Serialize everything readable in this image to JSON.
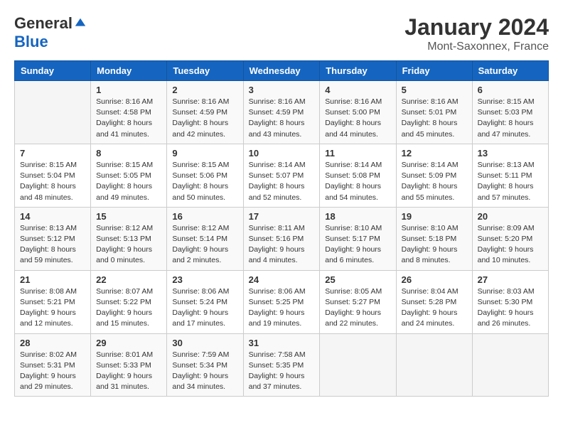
{
  "header": {
    "logo_general": "General",
    "logo_blue": "Blue",
    "month": "January 2024",
    "location": "Mont-Saxonnex, France"
  },
  "weekdays": [
    "Sunday",
    "Monday",
    "Tuesday",
    "Wednesday",
    "Thursday",
    "Friday",
    "Saturday"
  ],
  "weeks": [
    [
      {
        "day": "",
        "info": ""
      },
      {
        "day": "1",
        "info": "Sunrise: 8:16 AM\nSunset: 4:58 PM\nDaylight: 8 hours\nand 41 minutes."
      },
      {
        "day": "2",
        "info": "Sunrise: 8:16 AM\nSunset: 4:59 PM\nDaylight: 8 hours\nand 42 minutes."
      },
      {
        "day": "3",
        "info": "Sunrise: 8:16 AM\nSunset: 4:59 PM\nDaylight: 8 hours\nand 43 minutes."
      },
      {
        "day": "4",
        "info": "Sunrise: 8:16 AM\nSunset: 5:00 PM\nDaylight: 8 hours\nand 44 minutes."
      },
      {
        "day": "5",
        "info": "Sunrise: 8:16 AM\nSunset: 5:01 PM\nDaylight: 8 hours\nand 45 minutes."
      },
      {
        "day": "6",
        "info": "Sunrise: 8:15 AM\nSunset: 5:03 PM\nDaylight: 8 hours\nand 47 minutes."
      }
    ],
    [
      {
        "day": "7",
        "info": "Sunrise: 8:15 AM\nSunset: 5:04 PM\nDaylight: 8 hours\nand 48 minutes."
      },
      {
        "day": "8",
        "info": "Sunrise: 8:15 AM\nSunset: 5:05 PM\nDaylight: 8 hours\nand 49 minutes."
      },
      {
        "day": "9",
        "info": "Sunrise: 8:15 AM\nSunset: 5:06 PM\nDaylight: 8 hours\nand 50 minutes."
      },
      {
        "day": "10",
        "info": "Sunrise: 8:14 AM\nSunset: 5:07 PM\nDaylight: 8 hours\nand 52 minutes."
      },
      {
        "day": "11",
        "info": "Sunrise: 8:14 AM\nSunset: 5:08 PM\nDaylight: 8 hours\nand 54 minutes."
      },
      {
        "day": "12",
        "info": "Sunrise: 8:14 AM\nSunset: 5:09 PM\nDaylight: 8 hours\nand 55 minutes."
      },
      {
        "day": "13",
        "info": "Sunrise: 8:13 AM\nSunset: 5:11 PM\nDaylight: 8 hours\nand 57 minutes."
      }
    ],
    [
      {
        "day": "14",
        "info": "Sunrise: 8:13 AM\nSunset: 5:12 PM\nDaylight: 8 hours\nand 59 minutes."
      },
      {
        "day": "15",
        "info": "Sunrise: 8:12 AM\nSunset: 5:13 PM\nDaylight: 9 hours\nand 0 minutes."
      },
      {
        "day": "16",
        "info": "Sunrise: 8:12 AM\nSunset: 5:14 PM\nDaylight: 9 hours\nand 2 minutes."
      },
      {
        "day": "17",
        "info": "Sunrise: 8:11 AM\nSunset: 5:16 PM\nDaylight: 9 hours\nand 4 minutes."
      },
      {
        "day": "18",
        "info": "Sunrise: 8:10 AM\nSunset: 5:17 PM\nDaylight: 9 hours\nand 6 minutes."
      },
      {
        "day": "19",
        "info": "Sunrise: 8:10 AM\nSunset: 5:18 PM\nDaylight: 9 hours\nand 8 minutes."
      },
      {
        "day": "20",
        "info": "Sunrise: 8:09 AM\nSunset: 5:20 PM\nDaylight: 9 hours\nand 10 minutes."
      }
    ],
    [
      {
        "day": "21",
        "info": "Sunrise: 8:08 AM\nSunset: 5:21 PM\nDaylight: 9 hours\nand 12 minutes."
      },
      {
        "day": "22",
        "info": "Sunrise: 8:07 AM\nSunset: 5:22 PM\nDaylight: 9 hours\nand 15 minutes."
      },
      {
        "day": "23",
        "info": "Sunrise: 8:06 AM\nSunset: 5:24 PM\nDaylight: 9 hours\nand 17 minutes."
      },
      {
        "day": "24",
        "info": "Sunrise: 8:06 AM\nSunset: 5:25 PM\nDaylight: 9 hours\nand 19 minutes."
      },
      {
        "day": "25",
        "info": "Sunrise: 8:05 AM\nSunset: 5:27 PM\nDaylight: 9 hours\nand 22 minutes."
      },
      {
        "day": "26",
        "info": "Sunrise: 8:04 AM\nSunset: 5:28 PM\nDaylight: 9 hours\nand 24 minutes."
      },
      {
        "day": "27",
        "info": "Sunrise: 8:03 AM\nSunset: 5:30 PM\nDaylight: 9 hours\nand 26 minutes."
      }
    ],
    [
      {
        "day": "28",
        "info": "Sunrise: 8:02 AM\nSunset: 5:31 PM\nDaylight: 9 hours\nand 29 minutes."
      },
      {
        "day": "29",
        "info": "Sunrise: 8:01 AM\nSunset: 5:33 PM\nDaylight: 9 hours\nand 31 minutes."
      },
      {
        "day": "30",
        "info": "Sunrise: 7:59 AM\nSunset: 5:34 PM\nDaylight: 9 hours\nand 34 minutes."
      },
      {
        "day": "31",
        "info": "Sunrise: 7:58 AM\nSunset: 5:35 PM\nDaylight: 9 hours\nand 37 minutes."
      },
      {
        "day": "",
        "info": ""
      },
      {
        "day": "",
        "info": ""
      },
      {
        "day": "",
        "info": ""
      }
    ]
  ]
}
